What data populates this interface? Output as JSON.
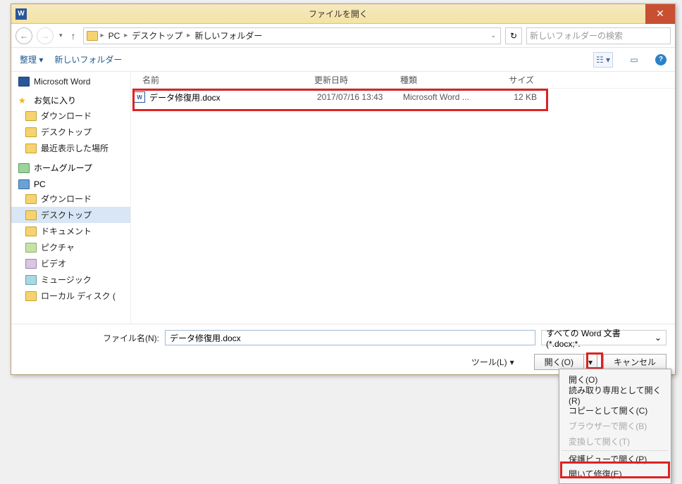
{
  "title": "ファイルを開く",
  "breadcrumb": [
    "PC",
    "デスクトップ",
    "新しいフォルダー"
  ],
  "search_placeholder": "新しいフォルダーの検索",
  "toolbar": {
    "organize": "整理 ▾",
    "newfolder": "新しいフォルダー"
  },
  "nav": {
    "word": "Microsoft Word",
    "fav": "お気に入り",
    "fav_items": [
      "ダウンロード",
      "デスクトップ",
      "最近表示した場所"
    ],
    "homegroup": "ホームグループ",
    "pc": "PC",
    "pc_items": [
      "ダウンロード",
      "デスクトップ",
      "ドキュメント",
      "ピクチャ",
      "ビデオ",
      "ミュージック",
      "ローカル ディスク ("
    ]
  },
  "columns": {
    "name": "名前",
    "date": "更新日時",
    "type": "種類",
    "size": "サイズ"
  },
  "file": {
    "name": "データ修復用.docx",
    "date": "2017/07/16 13:43",
    "type": "Microsoft Word ...",
    "size": "12 KB"
  },
  "footer": {
    "filename_label": "ファイル名(N):",
    "filename_value": "データ修復用.docx",
    "filter": "すべての Word 文書 (*.docx;*.",
    "tools": "ツール(L)",
    "open": "開く(O)",
    "cancel": "キャンセル"
  },
  "dropdown": [
    {
      "label": "開く(O)",
      "disabled": false
    },
    {
      "label": "読み取り専用として開く(R)",
      "disabled": false
    },
    {
      "label": "コピーとして開く(C)",
      "disabled": false
    },
    {
      "label": "ブラウザーで開く(B)",
      "disabled": true
    },
    {
      "label": "変換して開く(T)",
      "disabled": true
    },
    {
      "label": "保護ビューで開く(P)",
      "disabled": false
    },
    {
      "label": "開いて修復(E)",
      "disabled": false
    }
  ],
  "caret_v": "▾",
  "caret_v2": "⌄"
}
